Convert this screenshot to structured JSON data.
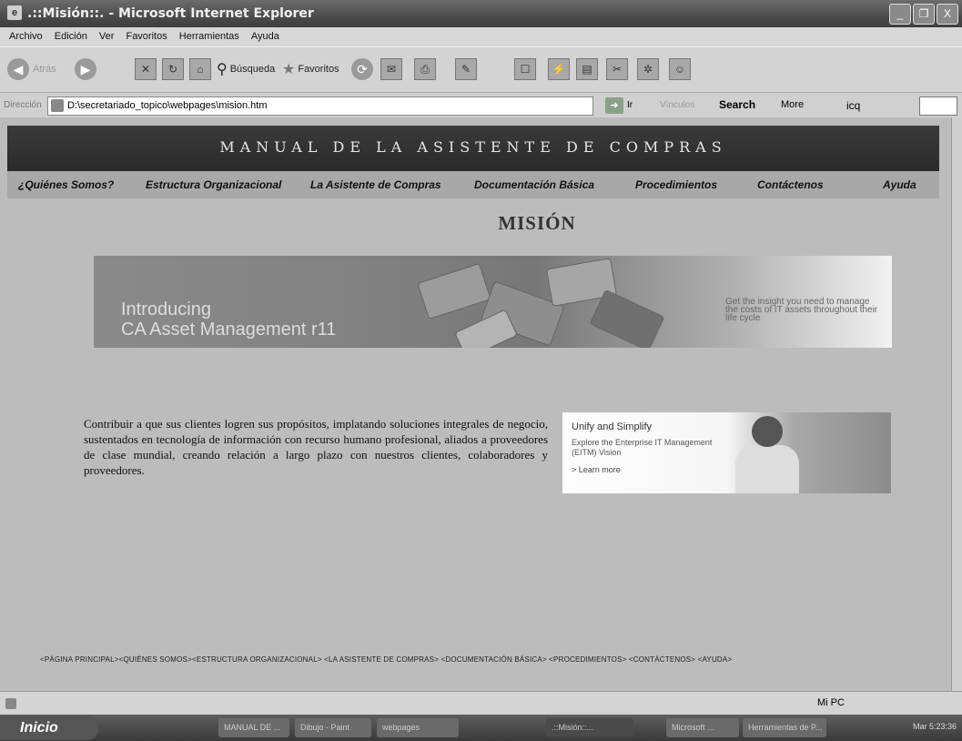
{
  "window": {
    "title": ".::Misión::. - Microsoft Internet Explorer",
    "buttons": [
      "_",
      "❐",
      "X"
    ]
  },
  "menu": [
    "Archivo",
    "Edición",
    "Ver",
    "Favoritos",
    "Herramientas",
    "Ayuda"
  ],
  "toolbar": {
    "back": "Atrás",
    "search": "Búsqueda",
    "favorites": "Favoritos"
  },
  "address": {
    "label": "Dirección",
    "value": "D:\\secretariado_topico\\webpages\\mision.htm",
    "go": "Ir",
    "links": "Vínculos",
    "search": "Search",
    "more": "More",
    "icq": "icq"
  },
  "banner": "MANUAL DE LA ASISTENTE DE COMPRAS",
  "nav": [
    "¿Quiénes Somos?",
    "Estructura Organizacional",
    "La Asistente de Compras",
    "Documentación Básica",
    "Procedimientos",
    "Contáctenos",
    "Ayuda"
  ],
  "page_title": "MISIÓN",
  "ad1": {
    "line1": "Introducing",
    "line2": "CA Asset Management r11",
    "tagline": "Get the insight you need to manage the costs of IT assets throughout their life cycle"
  },
  "mission_text": "Contribuir a que sus clientes logren sus propósitos, implatando soluciones integrales de negocio, sustentados en tecnología de información con recurso humano profesional, aliados a proveedores de clase mundial, creando relación a largo plazo con nuestros clientes, colaboradores y proveedores.",
  "ad2": {
    "heading": "Unify and Simplify",
    "sub": "Explore the Enterprise IT Management (EITM) Vision",
    "link": "> Learn more"
  },
  "footer_links": "<PÁGINA PRINCIPAL><QUIÉNES SOMOS><ESTRUCTURA ORGANIZACIONAL> <LA ASISTENTE DE COMPRAS> <DOCUMENTACIÓN BÁSICA> <PROCEDIMIENTOS> <CONTÁCTENOS> <AYUDA>",
  "status": {
    "zone": "Mi PC"
  },
  "taskbar": {
    "start": "Inicio",
    "tasks": [
      "MANUAL DE ...",
      "Dibujo - Paint",
      "webpages",
      ".::Misión::...",
      "Microsoft ...",
      "Herramientas de P..."
    ],
    "clock": "Mar 5:23:36"
  }
}
